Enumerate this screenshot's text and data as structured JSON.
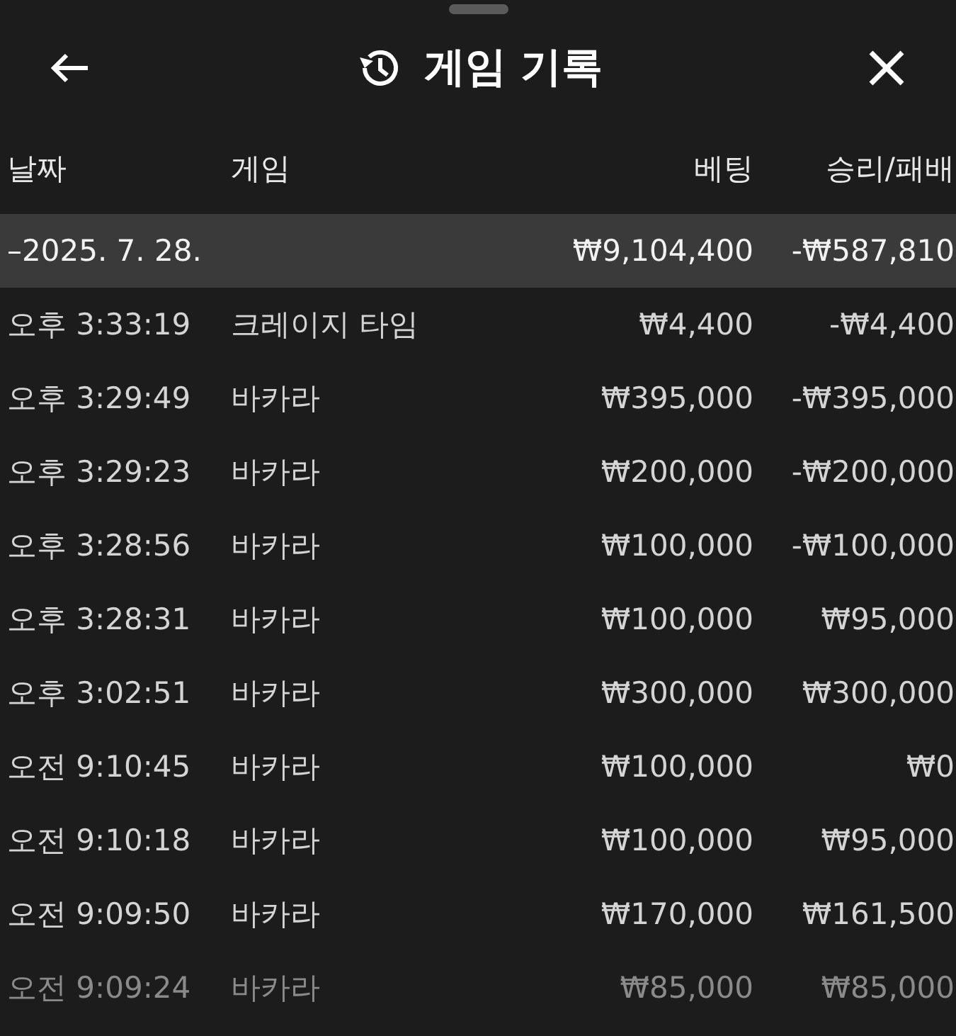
{
  "header": {
    "title": "게임 기록"
  },
  "columns": [
    "날짜",
    "게임",
    "베팅",
    "승리/패배"
  ],
  "group": {
    "date": "–2025. 7. 28.",
    "bet": "₩9,104,400",
    "result": "-₩587,810"
  },
  "rows": [
    {
      "time": "오후 3:33:19",
      "game": "크레이지 타임",
      "bet": "₩4,400",
      "result": "-₩4,400",
      "faded": false
    },
    {
      "time": "오후 3:29:49",
      "game": "바카라",
      "bet": "₩395,000",
      "result": "-₩395,000",
      "faded": false
    },
    {
      "time": "오후 3:29:23",
      "game": "바카라",
      "bet": "₩200,000",
      "result": "-₩200,000",
      "faded": false
    },
    {
      "time": "오후 3:28:56",
      "game": "바카라",
      "bet": "₩100,000",
      "result": "-₩100,000",
      "faded": false
    },
    {
      "time": "오후 3:28:31",
      "game": "바카라",
      "bet": "₩100,000",
      "result": "₩95,000",
      "faded": false
    },
    {
      "time": "오후 3:02:51",
      "game": "바카라",
      "bet": "₩300,000",
      "result": "₩300,000",
      "faded": false
    },
    {
      "time": "오전 9:10:45",
      "game": "바카라",
      "bet": "₩100,000",
      "result": "₩0",
      "faded": false
    },
    {
      "time": "오전 9:10:18",
      "game": "바카라",
      "bet": "₩100,000",
      "result": "₩95,000",
      "faded": false
    },
    {
      "time": "오전 9:09:50",
      "game": "바카라",
      "bet": "₩170,000",
      "result": "₩161,500",
      "faded": false
    },
    {
      "time": "오전 9:09:24",
      "game": "바카라",
      "bet": "₩85,000",
      "result": "₩85,000",
      "faded": true
    }
  ]
}
